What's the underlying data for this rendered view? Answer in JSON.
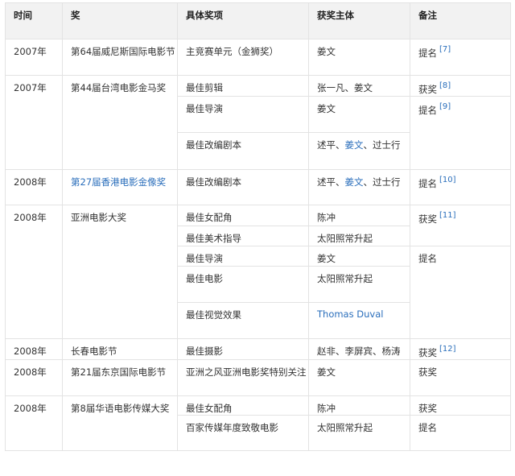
{
  "headers": [
    "时间",
    "奖",
    "具体奖项",
    "获奖主体",
    "备注"
  ],
  "r1": {
    "year": "2007年",
    "award": "第64届威尼斯国际电影节",
    "item": "主竞赛单元（金狮奖）",
    "winner": "姜文",
    "note": "提名",
    "ref": "[7]"
  },
  "r2": {
    "year": "2007年",
    "award": "第44届台湾电影金马奖",
    "items": [
      "最佳剪辑",
      "最佳导演",
      "最佳改编剧本"
    ],
    "winners": [
      "张一凡、姜文",
      "姜文"
    ],
    "w3a": "述平、",
    "w3b": "姜文",
    "w3c": "、过士行",
    "notes": [
      "获奖",
      "提名"
    ],
    "refs": [
      "[8]",
      "[9]"
    ]
  },
  "r3": {
    "year": "2008年",
    "award": "第27届香港电影金像奖",
    "item": "最佳改编剧本",
    "wa": "述平、",
    "wb": "姜文",
    "wc": "、过士行",
    "note": "提名",
    "ref": "[10]"
  },
  "r4": {
    "year": "2008年",
    "award": "亚洲电影大奖",
    "items": [
      "最佳女配角",
      "最佳美术指导",
      "最佳导演",
      "最佳电影",
      "最佳视觉效果"
    ],
    "winners": [
      "陈冲",
      "太阳照常升起",
      "姜文",
      "太阳照常升起",
      "Thomas Duval"
    ],
    "notes": [
      "获奖",
      "提名"
    ],
    "ref": "[11]"
  },
  "r5": {
    "year": "2008年",
    "award": "长春电影节",
    "item": "最佳摄影",
    "winner": "赵非、李屏宾、杨涛",
    "note": "获奖",
    "ref": "[12]"
  },
  "r6": {
    "year": "2008年",
    "award": "第21届东京国际电影节",
    "item": "亚洲之风亚洲电影奖特别关注",
    "winner": "姜文",
    "note": "获奖"
  },
  "r7": {
    "year": "2008年",
    "award": "第8届华语电影传媒大奖",
    "items": [
      "最佳女配角",
      "百家传媒年度致敬电影"
    ],
    "winners": [
      "陈冲",
      "太阳照常升起"
    ],
    "notes": [
      "获奖",
      "提名"
    ]
  }
}
